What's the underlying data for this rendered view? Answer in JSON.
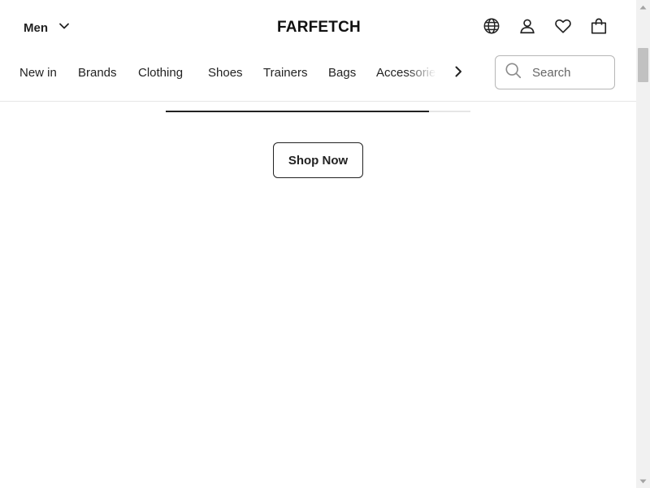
{
  "header": {
    "gender_selector": {
      "label": "Men",
      "icon": "chevron-down-icon"
    },
    "logo": "FARFETCH",
    "actions": [
      {
        "icon": "globe-icon"
      },
      {
        "icon": "user-icon"
      },
      {
        "icon": "heart-icon"
      },
      {
        "icon": "shopping-bag-icon"
      }
    ]
  },
  "nav": {
    "items": [
      {
        "label": "New in"
      },
      {
        "label": "Brands"
      },
      {
        "label": "Clothing"
      },
      {
        "label": "Shoes"
      },
      {
        "label": "Trainers"
      },
      {
        "label": "Bags"
      },
      {
        "label": "Accessories"
      }
    ],
    "next_icon": "chevron-right-icon"
  },
  "search": {
    "placeholder": "Search",
    "icon": "search-icon"
  },
  "carousel": {
    "progress_fraction": 0.864
  },
  "cta": {
    "label": "Shop Now"
  },
  "colors": {
    "text": "#222222",
    "border": "#b6b6b6",
    "divider": "#e6e6e6",
    "background": "#ffffff"
  }
}
